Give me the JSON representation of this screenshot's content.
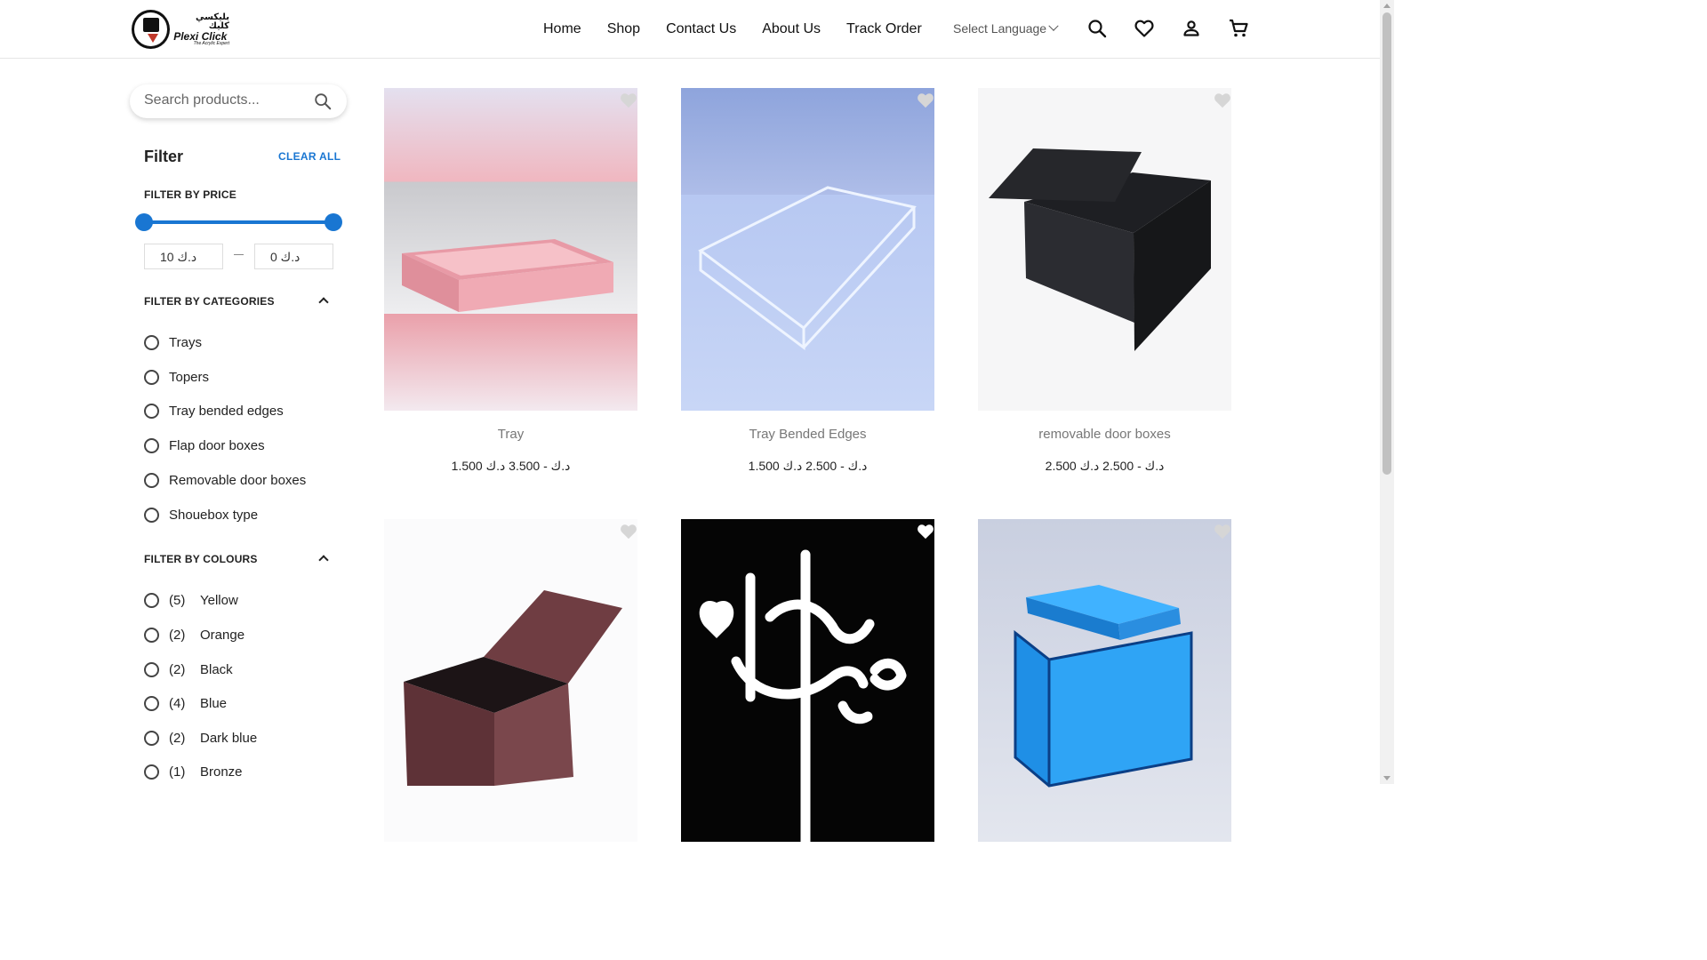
{
  "brand": {
    "name_en": "Plexi Click",
    "name_ar": "بليكسي كليك",
    "tagline": "The Acrylic Expert"
  },
  "nav": {
    "items": [
      "Home",
      "Shop",
      "Contact Us",
      "About Us",
      "Track Order"
    ],
    "language_label": "Select Language"
  },
  "header_icons": [
    "search-icon",
    "heart-icon",
    "account-icon",
    "cart-icon"
  ],
  "search": {
    "placeholder": "Search products..."
  },
  "filter": {
    "title": "Filter",
    "clear_all": "CLEAR ALL",
    "price_label": "FILTER BY PRICE",
    "price_min": "د.ك 10",
    "price_max": "د.ك 0",
    "categories_label": "FILTER BY CATEGORIES",
    "categories": [
      "Trays",
      "Topers",
      "Tray bended edges",
      "Flap door boxes",
      "Removable door boxes",
      "Shouebox type"
    ],
    "colours_label": "FILTER BY COLOURS",
    "colours": [
      {
        "count": "(5)",
        "name": "Yellow"
      },
      {
        "count": "(2)",
        "name": "Orange"
      },
      {
        "count": "(2)",
        "name": "Black"
      },
      {
        "count": "(4)",
        "name": "Blue"
      },
      {
        "count": "(2)",
        "name": "Dark blue"
      },
      {
        "count": "(1)",
        "name": "Bronze"
      }
    ]
  },
  "products": [
    {
      "name": "Tray",
      "price": "1.500 د.ك - 3.500 د.ك"
    },
    {
      "name": "Tray Bended Edges",
      "price": "1.500 د.ك - 2.500 د.ك"
    },
    {
      "name": "removable door boxes",
      "price": "2.500 د.ك - 2.500 د.ك"
    },
    {
      "name": "",
      "price": ""
    },
    {
      "name": "",
      "price": ""
    },
    {
      "name": "",
      "price": ""
    }
  ],
  "colors": {
    "accent": "#1976d2"
  }
}
